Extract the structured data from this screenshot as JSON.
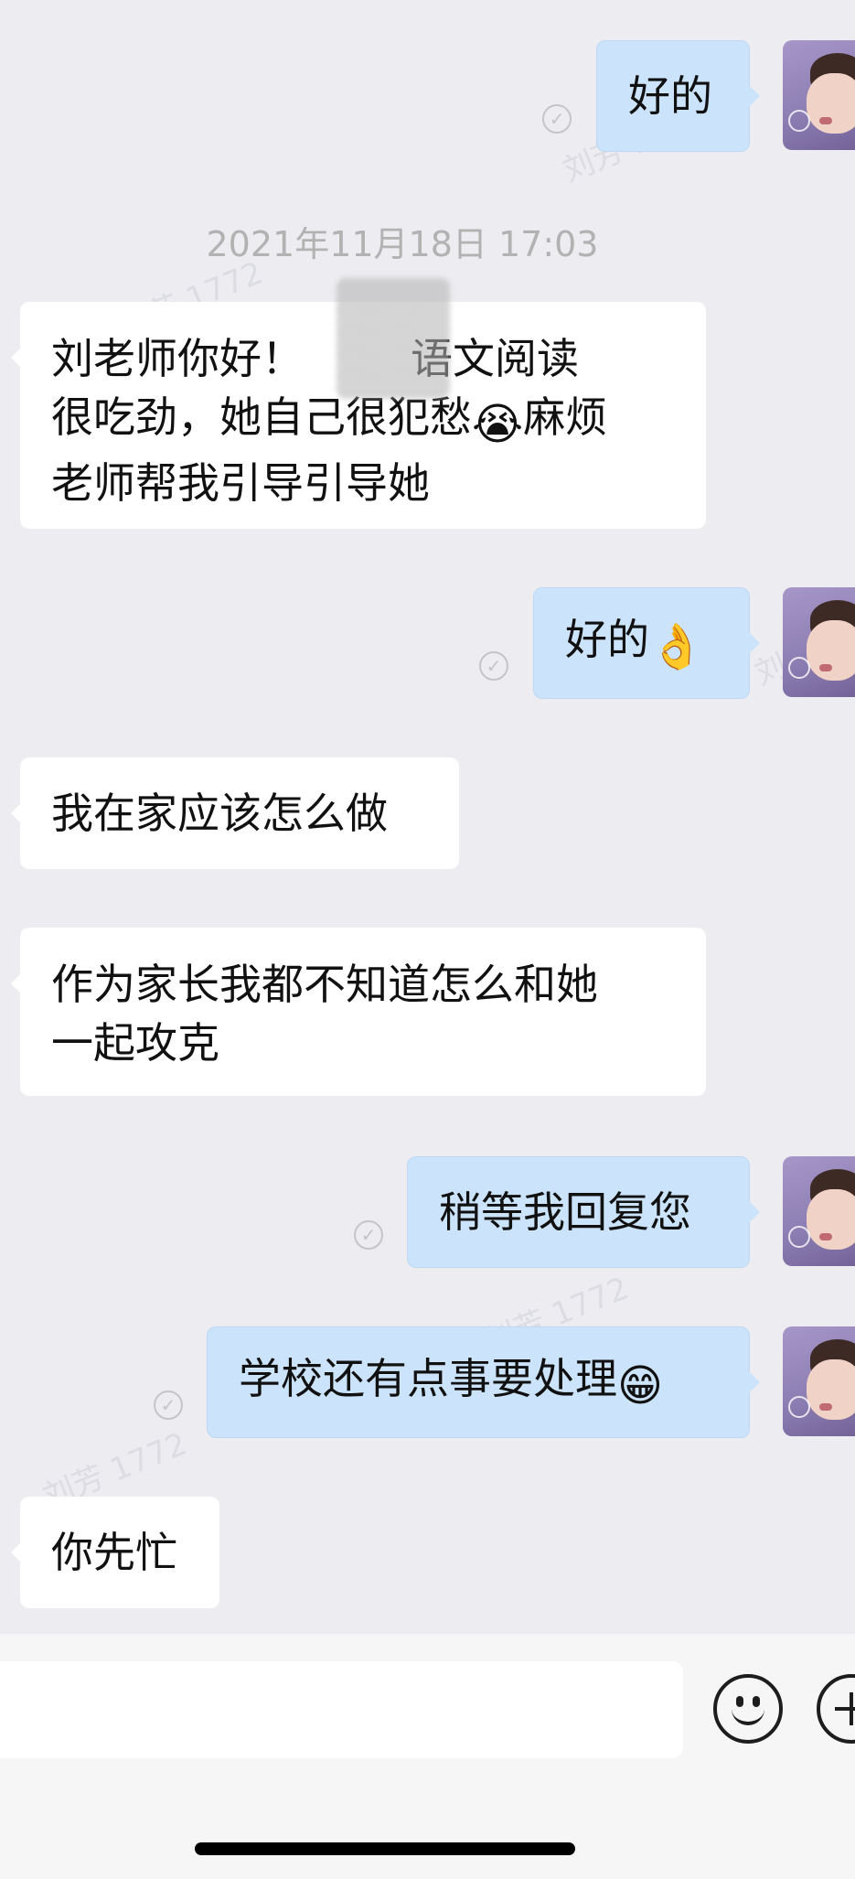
{
  "timestamp": "2021年11月18日 17:03",
  "watermark": "刘芳 1772",
  "messages": [
    {
      "dir": "out",
      "text": "好的",
      "emoji": ""
    },
    {
      "dir": "in",
      "text": "刘老师你好！        语文阅读\n很吃劲，她自己很犯愁",
      "emoji": "😭",
      "text2": "麻烦\n老师帮我引导引导她"
    },
    {
      "dir": "out",
      "text": "好的",
      "emoji": "👌"
    },
    {
      "dir": "in",
      "text": "我在家应该怎么做",
      "emoji": ""
    },
    {
      "dir": "in",
      "text": "作为家长我都不知道怎么和她\n一起攻克",
      "emoji": ""
    },
    {
      "dir": "out",
      "text": "稍等我回复您",
      "emoji": ""
    },
    {
      "dir": "out",
      "text": "学校还有点事要处理",
      "emoji": "😁"
    },
    {
      "dir": "in",
      "text": "你先忙",
      "emoji": ""
    }
  ],
  "status_icon": "read-check-icon",
  "input": {
    "placeholder": ""
  },
  "icons": {
    "emoji": "smiley-face-icon",
    "more": "plus-circle-icon"
  },
  "colors": {
    "outgoing_bubble": "#cce4fb",
    "incoming_bubble": "#ffffff",
    "background": "#ededf1"
  }
}
